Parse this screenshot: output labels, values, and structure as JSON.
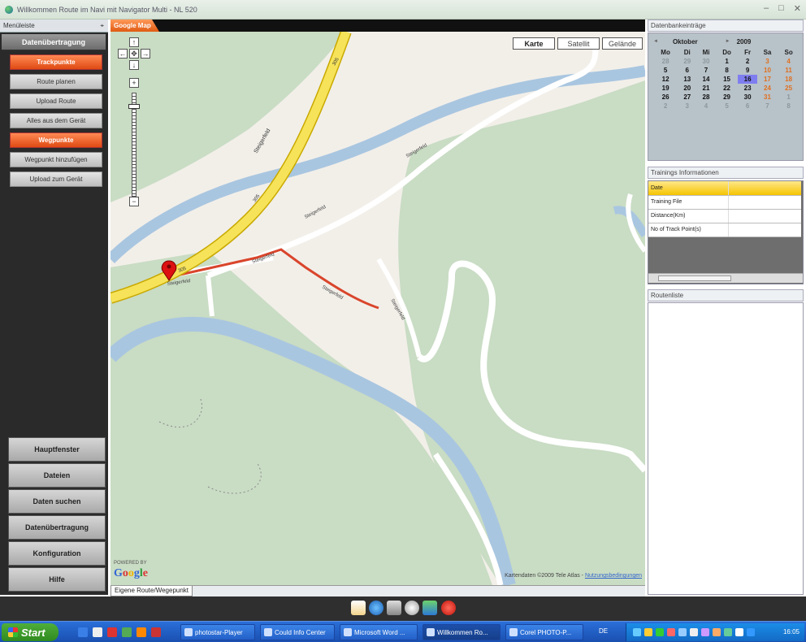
{
  "window": {
    "title": "Willkommen Route im Navi mit Navigator Multi - NL 520",
    "minimize": "–",
    "maximize": "□",
    "close": "✕"
  },
  "sidebar": {
    "header": "Menüleiste",
    "pin": "⌖",
    "section_transfer": "Datenübertragung",
    "section_tracks": "Trackpunkte",
    "track_buttons": [
      "Route planen",
      "Upload Route",
      "Alles aus dem Gerät"
    ],
    "section_waypoints": "Wegpunkte",
    "waypoint_buttons": [
      "Wegpunkt hinzufügen",
      "Upload zum Gerät"
    ],
    "main_buttons": [
      "Hauptfenster",
      "Dateien",
      "Daten suchen",
      "Datenübertragung",
      "Konfiguration",
      "Hilfe"
    ]
  },
  "map": {
    "tab": "Google Map",
    "maptypes": [
      "Karte",
      "Satellit",
      "Gelände"
    ],
    "zoom_in": "+",
    "zoom_out": "−",
    "pan_up": "↑",
    "pan_down": "↓",
    "pan_left": "←",
    "pan_right": "→",
    "pan_center": "✥",
    "road_labels": [
      "Steigerfeld",
      "Steigerfeld",
      "Steigerfeld",
      "Steigerfeld",
      "Steigerfeld",
      "Steigerfeld",
      "Steigerfeld"
    ],
    "road_numbers": [
      "305",
      "305",
      "305"
    ],
    "powered_by": "POWERED BY",
    "google_logo": "Google",
    "copyright": "Kartendaten ©2009 Tele Atlas -",
    "terms_link": "Nutzungsbedingungen",
    "bottom_tab": "Eigene Route/Wegepunkt"
  },
  "calendar": {
    "header": "Datenbankeinträge",
    "prev": "◄",
    "month": "Oktober",
    "next": "►",
    "year": "2009",
    "weekdays": [
      "Mo",
      "Di",
      "Mi",
      "Do",
      "Fr",
      "Sa",
      "So"
    ],
    "weeks": [
      [
        "28",
        "29",
        "30",
        "1",
        "2",
        "3",
        "4"
      ],
      [
        "5",
        "6",
        "7",
        "8",
        "9",
        "10",
        "11"
      ],
      [
        "12",
        "13",
        "14",
        "15",
        "16",
        "17",
        "18"
      ],
      [
        "19",
        "20",
        "21",
        "22",
        "23",
        "24",
        "25"
      ],
      [
        "26",
        "27",
        "28",
        "29",
        "30",
        "31",
        "1"
      ],
      [
        "2",
        "3",
        "4",
        "5",
        "6",
        "7",
        "8"
      ]
    ],
    "selected_day": "16"
  },
  "training": {
    "header": "Trainings Informationen",
    "rows": [
      "Date",
      "Training File",
      "Distance(Km)",
      "No of Track Point(s)"
    ]
  },
  "routelist": {
    "header": "Routenliste"
  },
  "taskbar": {
    "start": "Start",
    "tasks": [
      "photostar-Player",
      "Could Info Center",
      "Microsoft Word ...",
      "Willkommen Ro...",
      "Corel PHOTO-P..."
    ],
    "lang": "DE",
    "clock": "16:05"
  },
  "colors": {
    "accent_orange": "#e0581a",
    "highway_yellow": "#f6e35a",
    "route_red": "#d9452b",
    "river_blue": "#a9c6e0",
    "forest_green": "#c9dcc4"
  }
}
